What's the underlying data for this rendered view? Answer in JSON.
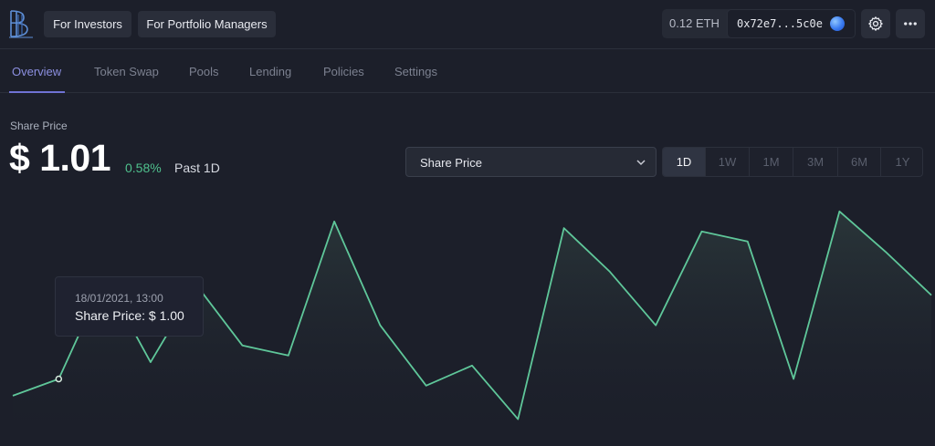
{
  "header": {
    "nav": [
      {
        "label": "For Investors"
      },
      {
        "label": "For Portfolio Managers"
      }
    ],
    "wallet": {
      "balance": "0.12 ETH",
      "address": "0x72e7...5c0e"
    },
    "icons": {
      "settings": "gear-icon",
      "more": "more-horizontal-icon"
    }
  },
  "tabs": [
    {
      "label": "Overview",
      "active": true
    },
    {
      "label": "Token Swap"
    },
    {
      "label": "Pools"
    },
    {
      "label": "Lending"
    },
    {
      "label": "Policies"
    },
    {
      "label": "Settings"
    }
  ],
  "price": {
    "label": "Share Price",
    "value": "$ 1.01",
    "change": "0.58%",
    "period": "Past 1D"
  },
  "metric_select": {
    "value": "Share Price"
  },
  "ranges": [
    {
      "label": "1D",
      "active": true
    },
    {
      "label": "1W"
    },
    {
      "label": "1M"
    },
    {
      "label": "3M"
    },
    {
      "label": "6M"
    },
    {
      "label": "1Y"
    }
  ],
  "tooltip": {
    "date": "18/01/2021, 13:00",
    "value": "Share Price: $ 1.00"
  },
  "colors": {
    "accent": "#8c8fe0",
    "line": "#5fc79a",
    "positive": "#4fc08d"
  },
  "chart_data": {
    "type": "area",
    "series": [
      {
        "values": [
          0.995,
          1.0,
          1.03,
          1.005,
          1.028,
          1.01,
          1.007,
          1.047,
          1.016,
          0.998,
          1.004,
          0.988,
          1.045,
          1.032,
          1.016,
          1.044,
          1.041,
          1.0,
          1.05,
          1.038,
          1.025
        ]
      }
    ],
    "highlight_index": 1,
    "ylim": [
      0.98,
      1.06
    ],
    "grid": false,
    "legend": "none"
  }
}
